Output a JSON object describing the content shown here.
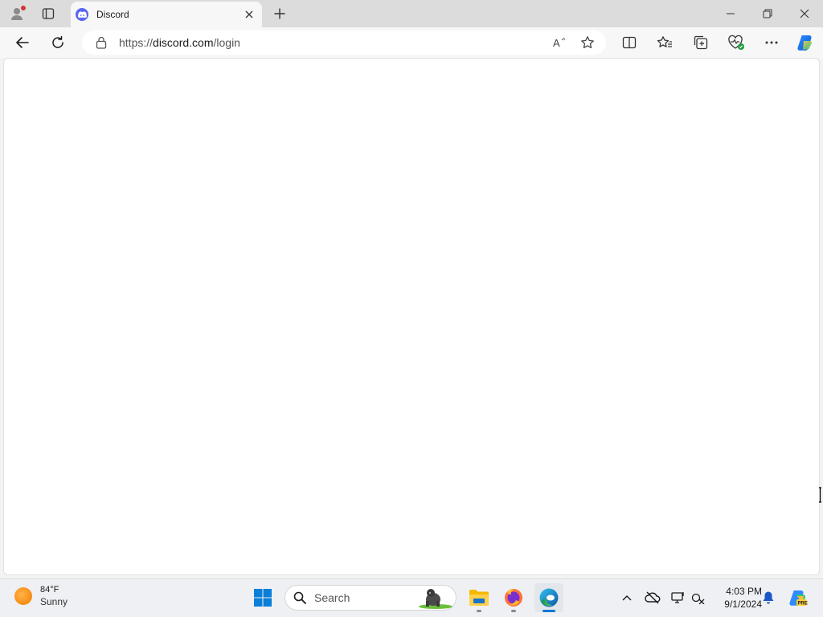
{
  "browser": {
    "tab": {
      "title": "Discord"
    },
    "address": {
      "protocol": "https://",
      "host": "discord.com",
      "path": "/login"
    }
  },
  "page": {
    "content": ""
  },
  "taskbar": {
    "weather": {
      "temp": "84°F",
      "condition": "Sunny"
    },
    "search": {
      "label": "Search"
    },
    "clock": {
      "time": "4:03 PM",
      "date": "9/1/2024"
    },
    "apps": [
      "start-icon",
      "search-icon",
      "file-explorer-icon",
      "firefox-icon",
      "edge-icon"
    ]
  },
  "colors": {
    "discord_blurple": "#5865f2",
    "edge_blue": "#0078d4",
    "titlebar": "#dcdcdc",
    "toolbar": "#f7f7f7"
  }
}
